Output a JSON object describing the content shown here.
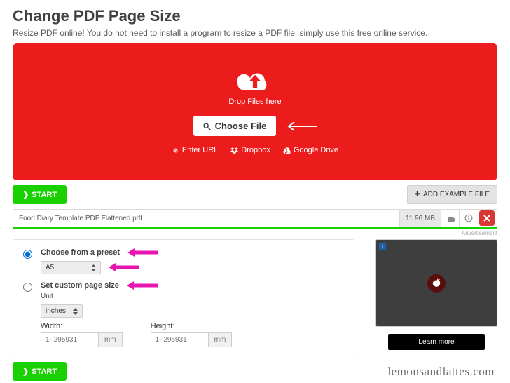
{
  "header": {
    "title": "Change PDF Page Size",
    "subtitle": "Resize PDF online! You do not need to install a program to resize a PDF file: simply use this free online service."
  },
  "dropzone": {
    "drop_label": "Drop Files here",
    "choose_file": "Choose File",
    "enter_url": "Enter URL",
    "dropbox": "Dropbox",
    "gdrive": "Google Drive"
  },
  "buttons": {
    "start": "START",
    "add_example": "ADD EXAMPLE FILE",
    "learn_more": "Learn more"
  },
  "file": {
    "name": "Food Diary Template PDF Flattened.pdf",
    "size": "11.96 MB"
  },
  "labels": {
    "advertisement": "Advertisement",
    "preset": "Choose from a preset",
    "custom": "Set custom page size",
    "unit": "Unit",
    "width": "Width:",
    "height": "Height:"
  },
  "settings": {
    "preset_value": "A5",
    "unit_value": "inches",
    "width_placeholder": "1- 295931",
    "height_placeholder": "1- 295931",
    "width_unit": "mm",
    "height_unit": "mm"
  },
  "watermark": "lemonsandlattes.com"
}
